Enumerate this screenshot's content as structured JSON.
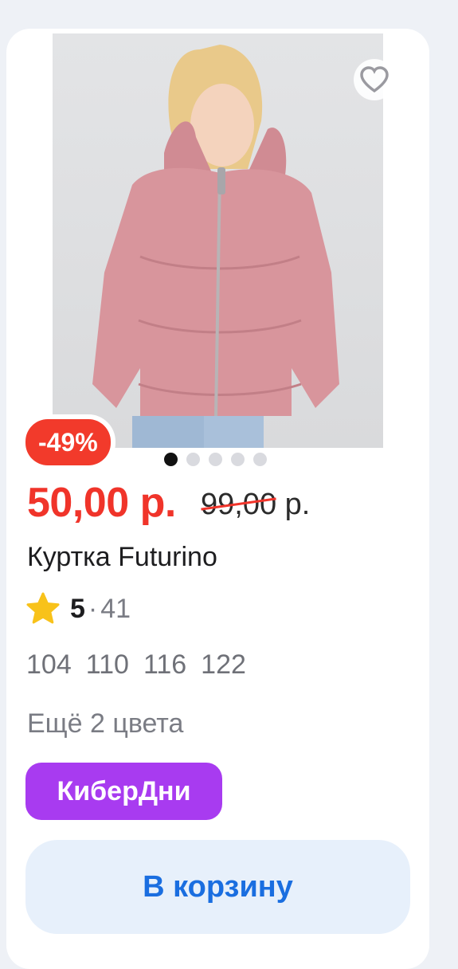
{
  "product": {
    "discount": "-49%",
    "price": "50,00 р.",
    "old_price": "99,00 р.",
    "title": "Куртка Futurino",
    "rating": "5",
    "rating_sep": "·",
    "reviews": "41",
    "sizes": [
      "104",
      "110",
      "116",
      "122"
    ],
    "more_colors": "Ещё 2 цвета",
    "promo_label": "КиберДни",
    "cart_button": "В корзину",
    "image_pages": 5,
    "active_image": 1
  },
  "colors": {
    "price": "#f0342a",
    "discount_bg": "#f23a2b",
    "promo_bg": "#a83bf0",
    "cart_text": "#1a6ee0",
    "cart_bg": "#e7f0fb",
    "jacket": "#d8959c"
  },
  "icons": {
    "favorite": "heart-icon",
    "rating": "star-icon"
  }
}
